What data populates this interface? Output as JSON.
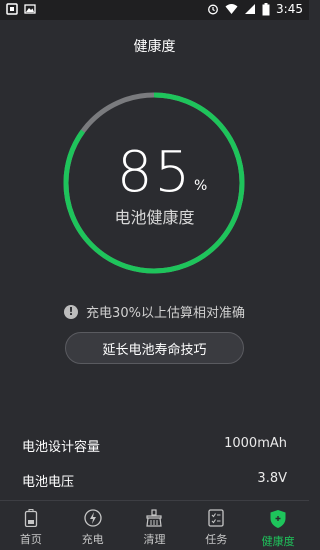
{
  "status_bar": {
    "time": "3:45"
  },
  "header": {
    "title": "健康度"
  },
  "health": {
    "percent": "85",
    "fraction": 0.85,
    "unit": "%",
    "label": "电池健康度"
  },
  "hint": {
    "icon": "info-icon",
    "text": "充电30%以上估算相对准确"
  },
  "tips_button": {
    "label": "延长电池寿命技巧"
  },
  "info": [
    {
      "label": "电池设计容量",
      "value": "1000mAh"
    },
    {
      "label": "电池电压",
      "value": "3.8V"
    }
  ],
  "tabs": [
    {
      "label": "首页",
      "icon": "battery-icon"
    },
    {
      "label": "充电",
      "icon": "lightning-icon"
    },
    {
      "label": "清理",
      "icon": "broom-icon"
    },
    {
      "label": "任务",
      "icon": "task-list-icon"
    },
    {
      "label": "健康度",
      "icon": "shield-icon"
    }
  ],
  "colors": {
    "accent": "#1ec45b",
    "ring_track": "#7a7b7e",
    "background": "#2b2c30"
  }
}
